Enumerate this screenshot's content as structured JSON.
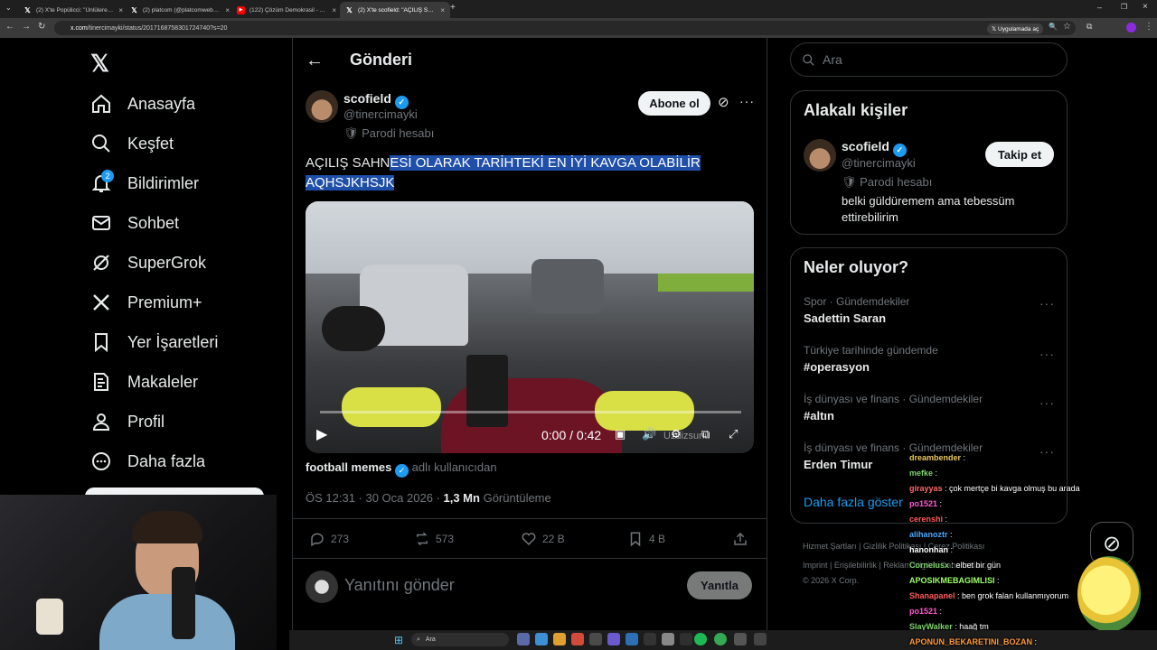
{
  "browser": {
    "tabs": [
      {
        "label": "(2) X'te Popülicci: \"Ünlülere yön…",
        "favicon": "x-icon"
      },
      {
        "label": "(2) platcom (@platcomweb) / X",
        "favicon": "x-icon"
      },
      {
        "label": "(122) Çözüm Demokrasil - YouT",
        "favicon": "youtube-icon"
      },
      {
        "label": "(2) X'te scofield: \"AÇILIŞ SAHN…",
        "favicon": "x-icon",
        "active": true
      }
    ],
    "url_domain": "x.com",
    "url_path": "/tinercimayki/status/2017168758301724740?s=20",
    "open_in_app": "Uygulamada aç"
  },
  "nav": {
    "items": [
      {
        "label": "Anasayfa",
        "icon": "home-icon"
      },
      {
        "label": "Keşfet",
        "icon": "search-icon"
      },
      {
        "label": "Bildirimler",
        "icon": "bell-icon",
        "badge": "2"
      },
      {
        "label": "Sohbet",
        "icon": "mail-icon"
      },
      {
        "label": "SuperGrok",
        "icon": "grok-icon"
      },
      {
        "label": "Premium+",
        "icon": "x-logo-icon"
      },
      {
        "label": "Yer İşaretleri",
        "icon": "bookmark-icon"
      },
      {
        "label": "Makaleler",
        "icon": "article-icon"
      },
      {
        "label": "Profil",
        "icon": "person-icon"
      },
      {
        "label": "Daha fazla",
        "icon": "more-circle-icon"
      }
    ]
  },
  "post": {
    "header_title": "Gönderi",
    "author_name": "scofield",
    "author_handle": "@tinercimayki",
    "parody_label": "Parodi hesabı",
    "subscribe_label": "Abone ol",
    "text_plain": "AÇILIŞ SAHN",
    "text_selected_1": "ESİ OLARAK TARİHTEKİ EN İYİ KAVGA OLABİLİR ",
    "text_selected_2": "AQHSJKHSJK",
    "video_time": "0:00 / 0:42",
    "video_watermark": "Uzdizsunu",
    "credit_name": "football memes",
    "credit_suffix": "adlı kullanıcıdan",
    "time": "ÖS 12:31 · 30 Oca 2026",
    "views_count": "1,3 Mn",
    "views_label": "Görüntüleme",
    "replies": "273",
    "reposts": "573",
    "likes": "22 B",
    "bookmarks": "4 B",
    "reply_placeholder": "Yanıtını gönder",
    "reply_button": "Yanıtla"
  },
  "right": {
    "search_placeholder": "Ara",
    "related_title": "Alakalı kişiler",
    "related_name": "scofield",
    "related_handle": "@tinercimayki",
    "related_parody": "Parodi hesabı",
    "related_bio": "belki güldüremem ama tebessüm ettirebilirim",
    "follow_label": "Takip et",
    "trends_title": "Neler oluyor?",
    "trends": [
      {
        "category": "Spor · Gündemdekiler",
        "name": "Sadettin Saran"
      },
      {
        "category": "Türkiye tarihinde gündemde",
        "name": "#operasyon"
      },
      {
        "category": "İş dünyası ve finans · Gündemdekiler",
        "name": "#altın"
      },
      {
        "category": "İş dünyası ve finans · Gündemdekiler",
        "name": "Erden Timur"
      }
    ],
    "show_more": "Daha fazla göster",
    "footer_row1": [
      "Hizmet Şartları",
      "Gizlilik Politikası",
      "Çerez Politikası"
    ],
    "footer_row2": [
      "Imprint",
      "Erişilebilirlik",
      "Reklam bilgileri",
      "Daha fazla ..."
    ],
    "copyright": "© 2026 X Corp."
  },
  "chat": [
    {
      "user": "dreambender",
      "msg": "",
      "color": "#e8c75e"
    },
    {
      "user": "mefke",
      "msg": "",
      "color": "#7fd36b"
    },
    {
      "user": "girayyas",
      "msg": "çok mertçe bi kavga olmuş bu arada",
      "color": "#ff6a6a"
    },
    {
      "user": "po1521",
      "msg": "",
      "color": "#ff5ad1"
    },
    {
      "user": "cerenshi",
      "msg": "",
      "color": "#ff5a5a"
    },
    {
      "user": "alihanoztr",
      "msg": "",
      "color": "#4aa8ff"
    },
    {
      "user": "hanonhan",
      "msg": "",
      "color": "#ffffff"
    },
    {
      "user": "Cornelusx",
      "msg": "elbet bir gün",
      "color": "#7fd36b"
    },
    {
      "user": "APOSIKMEBAGIMLISI",
      "msg": "",
      "color": "#9fff6a"
    },
    {
      "user": "Shanapanel",
      "msg": "ben grok falan kullanmıyorum",
      "color": "#ff5a5a"
    },
    {
      "user": "po1521",
      "msg": "",
      "color": "#ff5ad1"
    },
    {
      "user": "SlayWalker",
      "msg": "haağ tm",
      "color": "#7fd36b"
    },
    {
      "user": "APONUN_BEKARETINI_BOZAN",
      "msg": "",
      "color": "#ff9a3c"
    }
  ],
  "taskbar": {
    "search_placeholder": "Ara"
  },
  "colors": {
    "accent": "#1d9bf0",
    "background": "#000000",
    "highlight": "#1f4fa8"
  }
}
